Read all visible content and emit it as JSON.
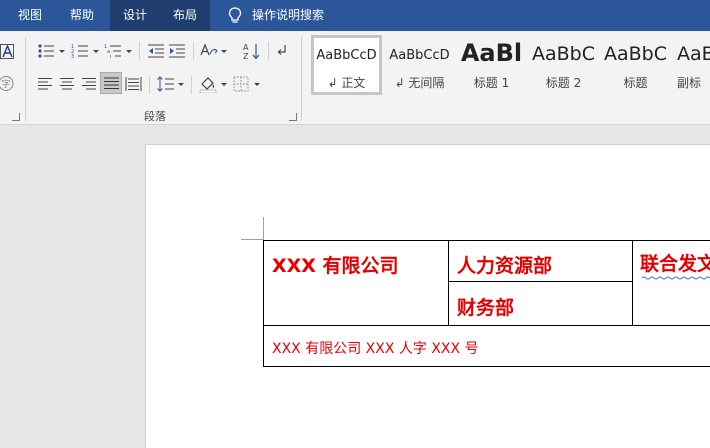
{
  "menubar": {
    "tabs": [
      {
        "label": "视图",
        "active": false
      },
      {
        "label": "帮助",
        "active": false
      },
      {
        "label": "设计",
        "active": true
      },
      {
        "label": "布局",
        "active": true
      }
    ],
    "search_label": "操作说明搜索"
  },
  "ribbon": {
    "paragraph_group_label": "段落",
    "styles": [
      {
        "preview": "AaBbCcD",
        "name": "↲ 正文",
        "selected": true
      },
      {
        "preview": "AaBbCcD",
        "name": "↲ 无间隔",
        "selected": false
      },
      {
        "preview": "AaBl",
        "name": "标题 1",
        "selected": false
      },
      {
        "preview": "AaBbC",
        "name": "标题 2",
        "selected": false
      },
      {
        "preview": "AaBbC",
        "name": "标题",
        "selected": false
      },
      {
        "preview": "AaB",
        "name": "副标",
        "selected": false
      }
    ]
  },
  "document": {
    "table": {
      "company": "XXX 有限公司",
      "dept_hr": "人力资源部",
      "dept_finance": "财务部",
      "joint_issue": "联合发文",
      "doc_number": "XXX 有限公司 XXX 人字 XXX 号"
    }
  },
  "colors": {
    "menubar_bg": "#2b579a",
    "document_red": "#e30000"
  }
}
